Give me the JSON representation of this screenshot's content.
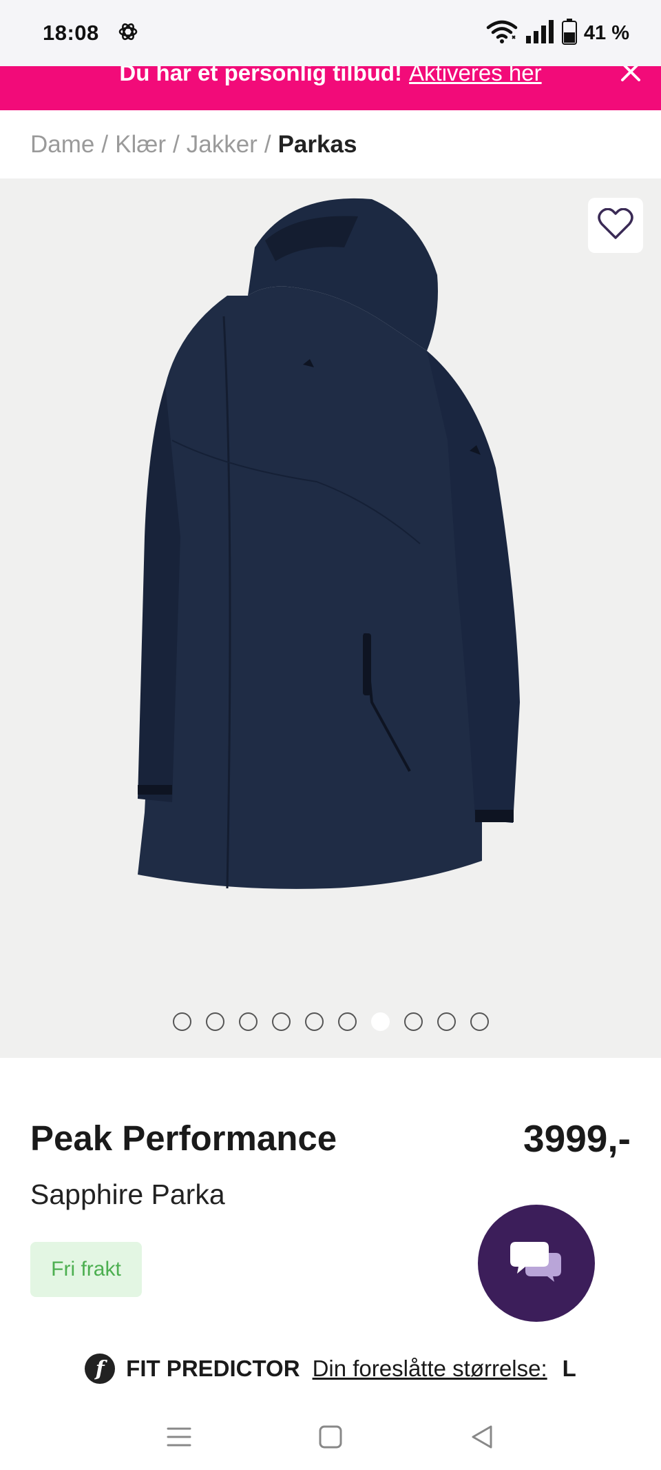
{
  "status_bar": {
    "time": "18:08",
    "battery": "41 %",
    "icons": [
      "openai-icon",
      "wifi-icon",
      "signal-icon",
      "battery-icon"
    ]
  },
  "promo": {
    "text": "Du har et personlig tilbud!",
    "link": "Aktiveres her",
    "background": "#f20b79"
  },
  "breadcrumb": {
    "items": [
      "Dame",
      "Klær",
      "Jakker"
    ],
    "current": "Parkas",
    "separator": "/"
  },
  "gallery": {
    "image_count": 10,
    "active_index": 6
  },
  "product": {
    "brand": "Peak Performance",
    "name": "Sapphire Parka",
    "price": "3999,-",
    "shipping_badge": "Fri frakt"
  },
  "fit_predictor": {
    "title": "FIT PREDICTOR",
    "link_text": "Din foreslåtte størrelse:",
    "size": "L"
  },
  "colors": {
    "accent": "#f20b79",
    "chat": "#3c1e5a",
    "badge_bg": "#e3f6e3",
    "badge_text": "#4caf50",
    "jacket": "#1f2c45"
  }
}
